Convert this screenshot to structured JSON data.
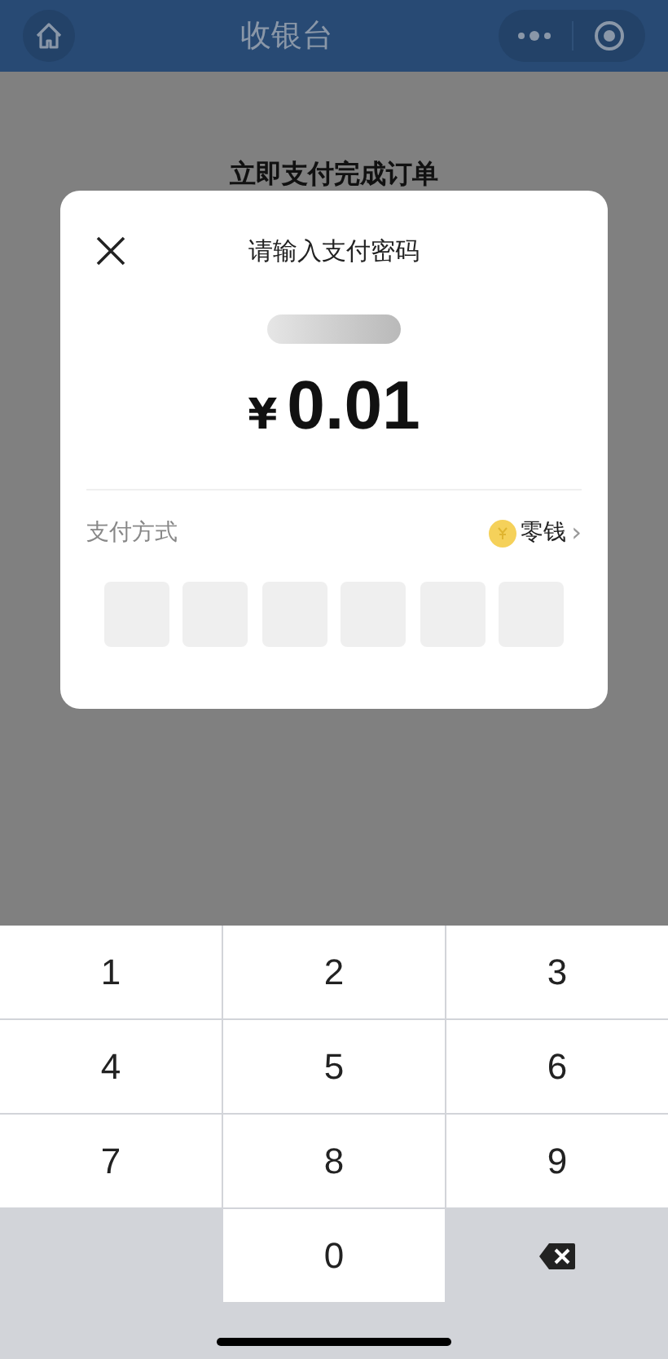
{
  "nav_bar": {
    "title": "收银台"
  },
  "page": {
    "heading": "立即支付完成订单"
  },
  "dialog": {
    "title": "请输入支付密码",
    "amount_symbol": "¥",
    "amount": "0.01",
    "method_label": "支付方式",
    "method_value": "零钱",
    "method_chevron": "›",
    "pin_boxes": [
      {
        "filled": false
      },
      {
        "filled": false
      },
      {
        "filled": false
      },
      {
        "filled": false
      },
      {
        "filled": false
      },
      {
        "filled": false
      }
    ]
  },
  "keypad": [
    {
      "kind": "digit",
      "label": "1"
    },
    {
      "kind": "digit",
      "label": "2"
    },
    {
      "kind": "digit",
      "label": "3"
    },
    {
      "kind": "digit",
      "label": "4"
    },
    {
      "kind": "digit",
      "label": "5"
    },
    {
      "kind": "digit",
      "label": "6"
    },
    {
      "kind": "digit",
      "label": "7"
    },
    {
      "kind": "digit",
      "label": "8"
    },
    {
      "kind": "digit",
      "label": "9"
    },
    {
      "kind": "blank"
    },
    {
      "kind": "digit",
      "label": "0"
    },
    {
      "kind": "delete"
    }
  ]
}
